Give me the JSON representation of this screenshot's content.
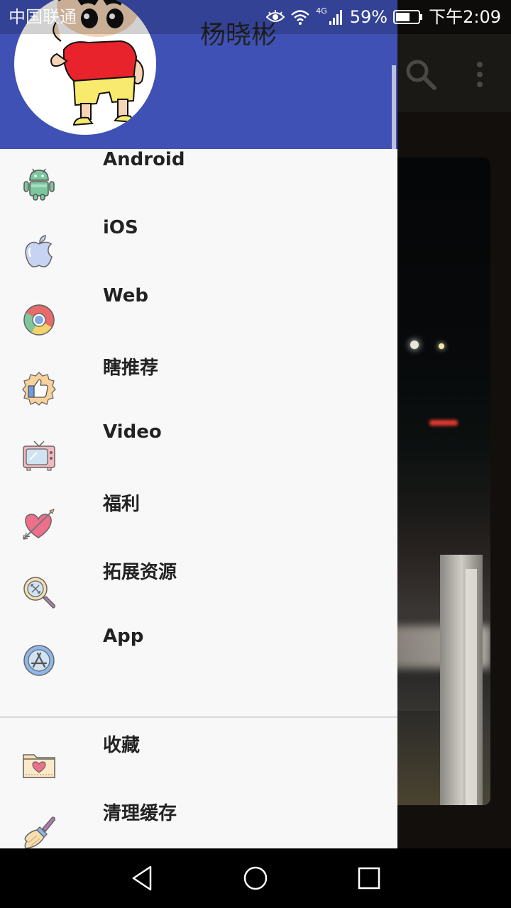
{
  "status_bar": {
    "carrier": "中国联通",
    "network": "4G",
    "battery": "59%",
    "time": "下午2:09"
  },
  "drawer": {
    "user_name": "杨晓彬",
    "menu": [
      {
        "label": "Android",
        "icon": "android-icon"
      },
      {
        "label": "iOS",
        "icon": "apple-icon"
      },
      {
        "label": "Web",
        "icon": "chrome-icon"
      },
      {
        "label": "瞎推荐",
        "icon": "thumbs-up-icon"
      },
      {
        "label": "Video",
        "icon": "tv-icon"
      },
      {
        "label": "福利",
        "icon": "heart-arrow-icon"
      },
      {
        "label": "拓展资源",
        "icon": "magnifier-icon"
      },
      {
        "label": "App",
        "icon": "app-store-icon"
      }
    ],
    "secondary_menu": [
      {
        "label": "收藏",
        "icon": "favorites-folder-icon"
      },
      {
        "label": "清理缓存",
        "icon": "broom-icon"
      }
    ]
  },
  "colors": {
    "header": "#3f51b5",
    "drawer_bg": "#f8f8f8",
    "label": "#222222"
  }
}
